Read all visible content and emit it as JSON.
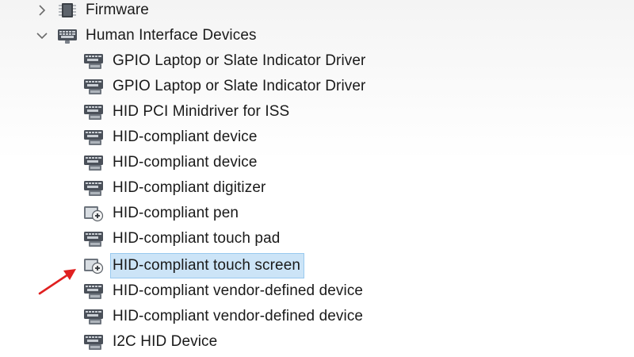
{
  "tree": {
    "firmware": {
      "label": "Firmware",
      "expanded": false,
      "chevron_icon": "chevron-right-icon",
      "icon": "firmware-chip-icon"
    },
    "hid": {
      "label": "Human Interface Devices",
      "expanded": true,
      "chevron_icon": "chevron-down-icon",
      "icon": "hid-category-icon",
      "items": [
        {
          "label": "GPIO Laptop or Slate Indicator Driver",
          "icon": "hid-device-icon"
        },
        {
          "label": "GPIO Laptop or Slate Indicator Driver",
          "icon": "hid-device-icon"
        },
        {
          "label": "HID PCI Minidriver for ISS",
          "icon": "hid-device-icon"
        },
        {
          "label": "HID-compliant device",
          "icon": "hid-device-icon"
        },
        {
          "label": "HID-compliant device",
          "icon": "hid-device-icon"
        },
        {
          "label": "HID-compliant digitizer",
          "icon": "hid-device-icon"
        },
        {
          "label": "HID-compliant pen",
          "icon": "pen-device-icon"
        },
        {
          "label": "HID-compliant touch pad",
          "icon": "hid-device-icon"
        },
        {
          "label": "HID-compliant touch screen",
          "icon": "touch-screen-device-icon",
          "selected": true
        },
        {
          "label": "HID-compliant vendor-defined device",
          "icon": "hid-device-icon"
        },
        {
          "label": "HID-compliant vendor-defined device",
          "icon": "hid-device-icon"
        },
        {
          "label": "I2C HID Device",
          "icon": "hid-device-icon"
        }
      ]
    }
  },
  "annotation": {
    "icon": "red-arrow-icon",
    "color": "#e02020",
    "points_to": "HID-compliant touch screen"
  },
  "colors": {
    "selection_bg": "#cce4f7",
    "selection_border": "#99c9ef",
    "text": "#1a1a1a"
  }
}
